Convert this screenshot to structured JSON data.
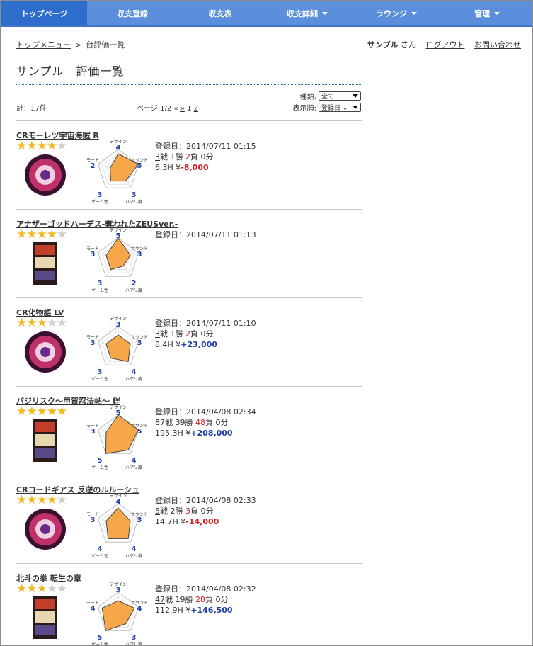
{
  "nav": {
    "items": [
      {
        "label": "トップページ",
        "active": true,
        "dropdown": false
      },
      {
        "label": "収支登録",
        "active": false,
        "dropdown": false
      },
      {
        "label": "収支表",
        "active": false,
        "dropdown": false
      },
      {
        "label": "収支詳細",
        "active": false,
        "dropdown": true
      },
      {
        "label": "ラウンジ",
        "active": false,
        "dropdown": true
      },
      {
        "label": "管理",
        "active": false,
        "dropdown": true
      }
    ]
  },
  "breadcrumb": {
    "home": "トップメニュー",
    "sep": ">",
    "current": "台評価一覧"
  },
  "user": {
    "name": "サンプル",
    "suffix": " さん",
    "logout": "ログアウト",
    "contact": "お問い合わせ"
  },
  "page_title": "サンプル　評価一覧",
  "filter": {
    "type_label": "種類:",
    "type_value": "全て",
    "order_label": "表示順:",
    "order_value": "登録日 ↓"
  },
  "count": "計：17件",
  "pager": {
    "label": "ページ:1/2 «",
    "next": "»",
    "page1": "1",
    "page2": "2"
  },
  "radar_labels": {
    "design": "デザイン",
    "sound": "サウンド",
    "hamari": "ハマリ度",
    "game": "ゲーム性",
    "mode": "モード"
  },
  "colors": {
    "nav": "#5b8fdc",
    "nav_active": "#2f6dcc",
    "radar_fill": "#f5a74a",
    "score": "#1f3fa8",
    "loss": "#d32020",
    "star": "#f3b71f"
  },
  "entries": [
    {
      "title": "CRモーレツ宇宙海賊 R",
      "stars": 4,
      "thumb": "pachinko-round",
      "ratings": {
        "design": 4,
        "sound": 5,
        "hamari": 3,
        "game": 3,
        "mode": 2
      },
      "date": "登録日：2014/07/11 01:15",
      "battles": "3",
      "battle_suffix": "戦 1勝 ",
      "losses": "2",
      "loss_suffix": "負 0分",
      "hours": "6.3H ¥",
      "result": "-8,000",
      "result_sign": "neg"
    },
    {
      "title": "アナザーゴッドハーデス-奪われたZEUSver.-",
      "stars": 4,
      "thumb": "slot-cabinet",
      "ratings": {
        "design": 5,
        "sound": 3,
        "hamari": 2,
        "game": 3,
        "mode": 3
      },
      "date": "登録日：2014/07/11 01:13",
      "battles": "",
      "battle_suffix": "",
      "losses": "",
      "loss_suffix": "",
      "hours": "",
      "result": "",
      "result_sign": ""
    },
    {
      "title": "CR化物語 LV",
      "stars": 3,
      "thumb": "pachinko-round",
      "ratings": {
        "design": 3,
        "sound": 3,
        "hamari": 4,
        "game": 3,
        "mode": 3
      },
      "date": "登録日：2014/07/11 01:10",
      "battles": "3",
      "battle_suffix": "戦 1勝 ",
      "losses": "2",
      "loss_suffix": "負 0分",
      "hours": "8.4H ¥",
      "result": "+23,000",
      "result_sign": "pos"
    },
    {
      "title": "バジリスク～甲賀忍法帖～ 絆",
      "stars": 5,
      "thumb": "slot-cabinet",
      "ratings": {
        "design": 5,
        "sound": 5,
        "hamari": 4,
        "game": 5,
        "mode": 3
      },
      "date": "登録日：2014/04/08 02:34",
      "battles": "87",
      "battle_suffix": "戦 39勝 ",
      "losses": "48",
      "loss_suffix": "負 0分",
      "hours": "195.3H ¥",
      "result": "+208,000",
      "result_sign": "pos"
    },
    {
      "title": "CRコードギアス 反逆のルルーシュ",
      "stars": 4,
      "thumb": "pachinko-round",
      "ratings": {
        "design": 4,
        "sound": 3,
        "hamari": 4,
        "game": 4,
        "mode": 3
      },
      "date": "登録日：2014/04/08 02:33",
      "battles": "5",
      "battle_suffix": "戦 2勝 ",
      "losses": "3",
      "loss_suffix": "負 0分",
      "hours": "14.7H ¥",
      "result": "-14,000",
      "result_sign": "neg"
    },
    {
      "title": "北斗の拳 転生の章",
      "stars": 3,
      "thumb": "slot-cabinet",
      "ratings": {
        "design": 3,
        "sound": 4,
        "hamari": 3,
        "game": 5,
        "mode": 4
      },
      "date": "登録日：2014/04/08 02:32",
      "battles": "47",
      "battle_suffix": "戦 19勝 ",
      "losses": "28",
      "loss_suffix": "負 0分",
      "hours": "112.9H ¥",
      "result": "+146,500",
      "result_sign": "pos"
    }
  ]
}
